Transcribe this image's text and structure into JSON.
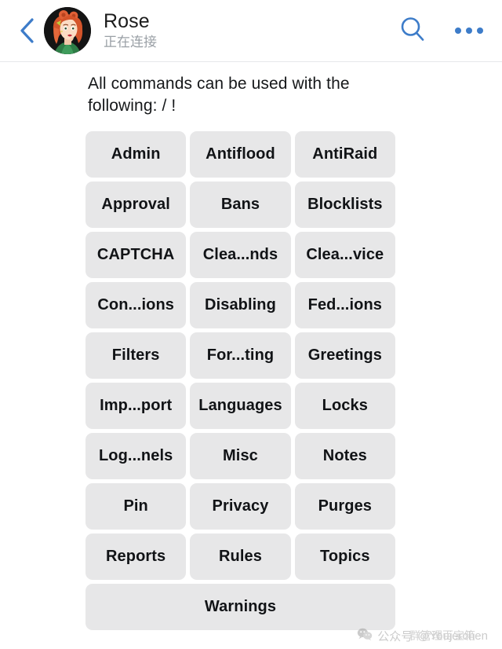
{
  "header": {
    "back_icon": "chevron-left-icon",
    "avatar_alt": "rose-avatar",
    "title": "Rose",
    "status": "正在连接",
    "search_icon": "search-icon",
    "menu_icon": "more-options-icon",
    "accent_color": "#3d7cc9"
  },
  "message": {
    "text": "All commands can be used with the following: / !"
  },
  "keyboard": {
    "button_bg": "#e7e7e8",
    "rows": [
      [
        "Admin",
        "Antiflood",
        "AntiRaid"
      ],
      [
        "Approval",
        "Bans",
        "Blocklists"
      ],
      [
        "CAPTCHA",
        "Clea...nds",
        "Clea...vice"
      ],
      [
        "Con...ions",
        "Disabling",
        "Fed...ions"
      ],
      [
        "Filters",
        "For...ting",
        "Greetings"
      ],
      [
        "Imp...port",
        "Languages",
        "Locks"
      ],
      [
        "Log...nels",
        "Misc",
        "Notes"
      ],
      [
        "Pin",
        "Privacy",
        "Purges"
      ],
      [
        "Reports",
        "Rules",
        "Topics"
      ],
      [
        "Warnings"
      ]
    ]
  },
  "watermark": {
    "label": "公众号",
    "handle": "@Youjerchen",
    "overlay": "群管理百宝箱"
  }
}
